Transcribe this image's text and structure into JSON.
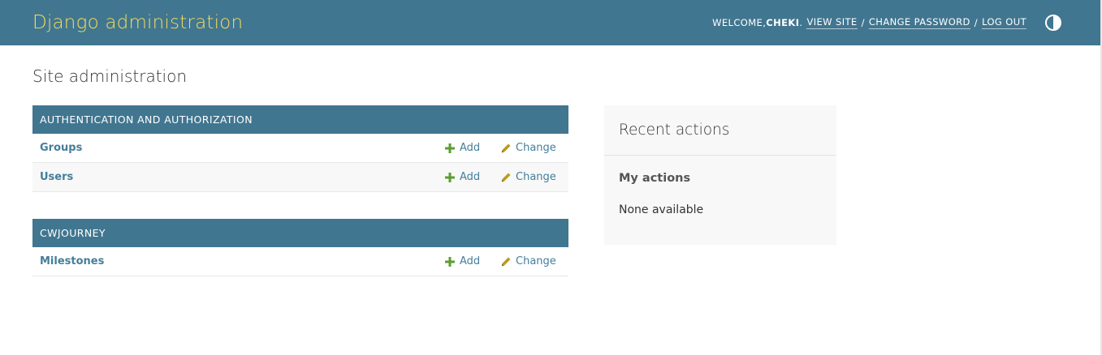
{
  "header": {
    "branding": "Django administration",
    "welcome_prefix": "WELCOME, ",
    "username": "CHEKI",
    "username_suffix": ".",
    "view_site": "VIEW SITE",
    "change_password": "CHANGE PASSWORD",
    "log_out": "LOG OUT",
    "separator": "/",
    "theme_icon": "contrast-half-circle-icon"
  },
  "page_title": "Site administration",
  "modules": [
    {
      "caption": "AUTHENTICATION AND AUTHORIZATION",
      "rows": [
        {
          "name": "Groups",
          "add": "Add",
          "change": "Change"
        },
        {
          "name": "Users",
          "add": "Add",
          "change": "Change"
        }
      ]
    },
    {
      "caption": "CWJOURNEY",
      "rows": [
        {
          "name": "Milestones",
          "add": "Add",
          "change": "Change"
        }
      ]
    }
  ],
  "recent_actions": {
    "title": "Recent actions",
    "my_actions": "My actions",
    "empty": "None available"
  },
  "colors": {
    "header_bg": "#417690",
    "branding": "#f5dd5d",
    "link": "#447e9b",
    "add_icon": "#5b9e2f",
    "change_icon": "#b99a20"
  }
}
